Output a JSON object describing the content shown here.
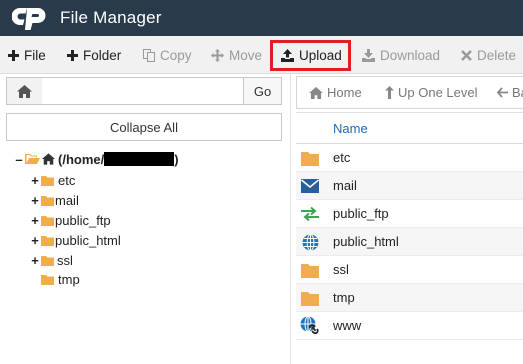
{
  "header": {
    "title": "File Manager"
  },
  "toolbar": {
    "file": "File",
    "folder": "Folder",
    "copy": "Copy",
    "move": "Move",
    "upload": "Upload",
    "download": "Download",
    "delete": "Delete"
  },
  "path": {
    "value": "",
    "go_label": "Go"
  },
  "collapse_label": "Collapse All",
  "tree": {
    "root_label": "(/home/",
    "root_suffix": ")",
    "items": [
      "etc",
      "mail",
      "public_ftp",
      "public_html",
      "ssl",
      "tmp"
    ]
  },
  "right_toolbar": {
    "home": "Home",
    "up": "Up One Level",
    "back": "Ba"
  },
  "table": {
    "header": "Name",
    "rows": [
      {
        "name": "etc",
        "icon": "folder-icon"
      },
      {
        "name": "mail",
        "icon": "envelope-icon"
      },
      {
        "name": "public_ftp",
        "icon": "exchange-arrows-icon"
      },
      {
        "name": "public_html",
        "icon": "globe-icon"
      },
      {
        "name": "ssl",
        "icon": "folder-icon"
      },
      {
        "name": "tmp",
        "icon": "folder-icon"
      },
      {
        "name": "www",
        "icon": "globe-link-icon"
      }
    ]
  },
  "colors": {
    "header_bg": "#293a4a",
    "folder": "#f0ad4e",
    "link": "#1a6bb5",
    "highlight": "#e21d24"
  }
}
